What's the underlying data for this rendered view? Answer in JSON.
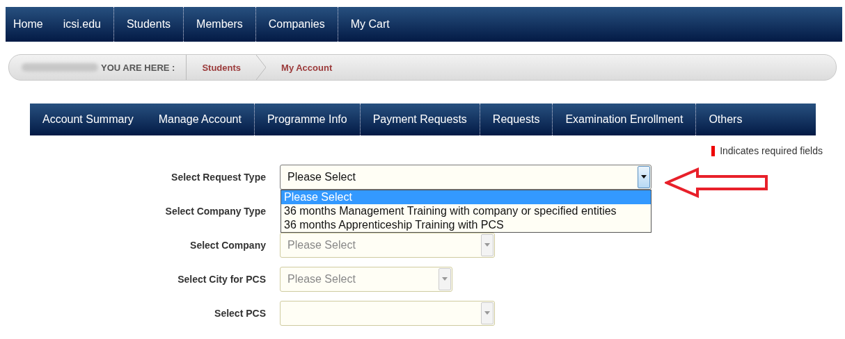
{
  "top_nav": [
    {
      "label": "Home",
      "divider": false
    },
    {
      "label": "icsi.edu",
      "divider": false
    },
    {
      "label": "Students",
      "divider": true
    },
    {
      "label": "Members",
      "divider": true
    },
    {
      "label": "Companies",
      "divider": true
    },
    {
      "label": "My Cart",
      "divider": true
    }
  ],
  "breadcrumb": {
    "redacted": true,
    "prefix": "YOU ARE HERE :",
    "items": [
      "Students",
      "My Account"
    ]
  },
  "account_nav": [
    {
      "label": "Account Summary",
      "divider": false
    },
    {
      "label": "Manage Account",
      "divider": false
    },
    {
      "label": "Programme Info",
      "divider": true
    },
    {
      "label": "Payment Requests",
      "divider": true
    },
    {
      "label": "Requests",
      "divider": true
    },
    {
      "label": "Examination Enrollment",
      "divider": true
    },
    {
      "label": "Others",
      "divider": true
    }
  ],
  "required_note": "Indicates required fields",
  "form": [
    {
      "kind": "select",
      "label": "Select Request Type",
      "value": "Please Select",
      "disabled": false,
      "open": true,
      "options": [
        {
          "label": "Please Select",
          "selected": true
        },
        {
          "label": "36 months Management Training with company or specified entities",
          "selected": false
        },
        {
          "label": "36 months Apprenticeship Training with PCS",
          "selected": false
        }
      ]
    },
    {
      "kind": "label",
      "label": "Select Company Type"
    },
    {
      "kind": "select",
      "label": "Select Company",
      "value": "Please Select",
      "disabled": true,
      "open": false
    },
    {
      "kind": "select",
      "label": "Select City for PCS",
      "value": "Please Select",
      "disabled": true,
      "open": false
    },
    {
      "kind": "select",
      "label": "Select PCS",
      "disabled": true,
      "open": false
    }
  ],
  "annotation": {
    "kind": "arrow"
  }
}
